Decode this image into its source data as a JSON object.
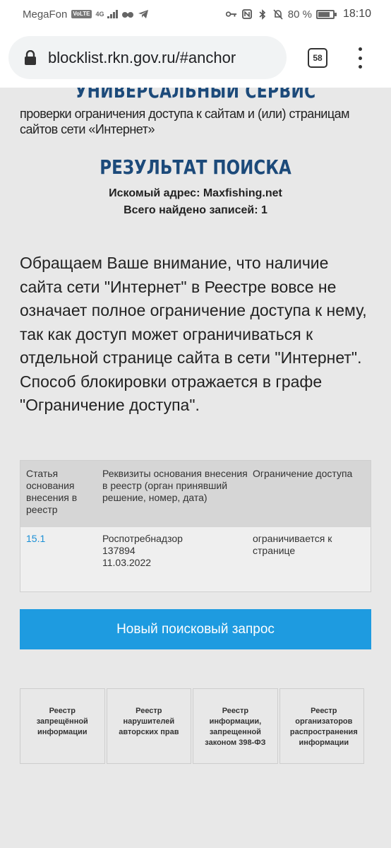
{
  "status_bar": {
    "carrier": "MegaFon",
    "volte": "VoLTE",
    "network": "4G",
    "battery_percent": "80 %",
    "battery_level": 0.8,
    "time": "18:10"
  },
  "browser": {
    "url": "blocklist.rkn.gov.ru/#anchor",
    "tab_count": "58"
  },
  "page": {
    "service_heading": "УНИВЕРСАЛЬНЫЙ СЕРВИС",
    "service_subtitle": "проверки ограничения доступа к сайтам и (или) страницам сайтов сети «Интернет»",
    "result_title": "РЕЗУЛЬТАТ ПОИСКА",
    "searched_address": "Искомый адрес: Maxfishing.net",
    "records_found": "Всего найдено записей: 1",
    "notice": "Обращаем Ваше внимание, что наличие сайта сети \"Интернет\" в Реестре вовсе не означает полное ограничение доступа к нему, так как доступ может ограничиваться к отдельной странице сайта в сети \"Интернет\". Способ блокировки отражается в графе \"Ограничение доступа\".",
    "table": {
      "headers": [
        "Статья основания внесения в реестр",
        "Реквизиты основания внесения в реестр (орган принявший решение, номер, дата)",
        "Ограничение доступа"
      ],
      "rows": [
        {
          "article": "15.1",
          "authority": "Роспотребнадзор",
          "number": "137894",
          "date": "11.03.2022",
          "restriction": "ограничивается к странице"
        }
      ]
    },
    "new_search_button": "Новый поисковый запрос",
    "footer_links": [
      "Реестр запрещённой информации",
      "Реестр нарушителей авторских прав",
      "Реестр информации, запрещенной законом 398-ФЗ",
      "Реестр организаторов распространения информации"
    ]
  }
}
